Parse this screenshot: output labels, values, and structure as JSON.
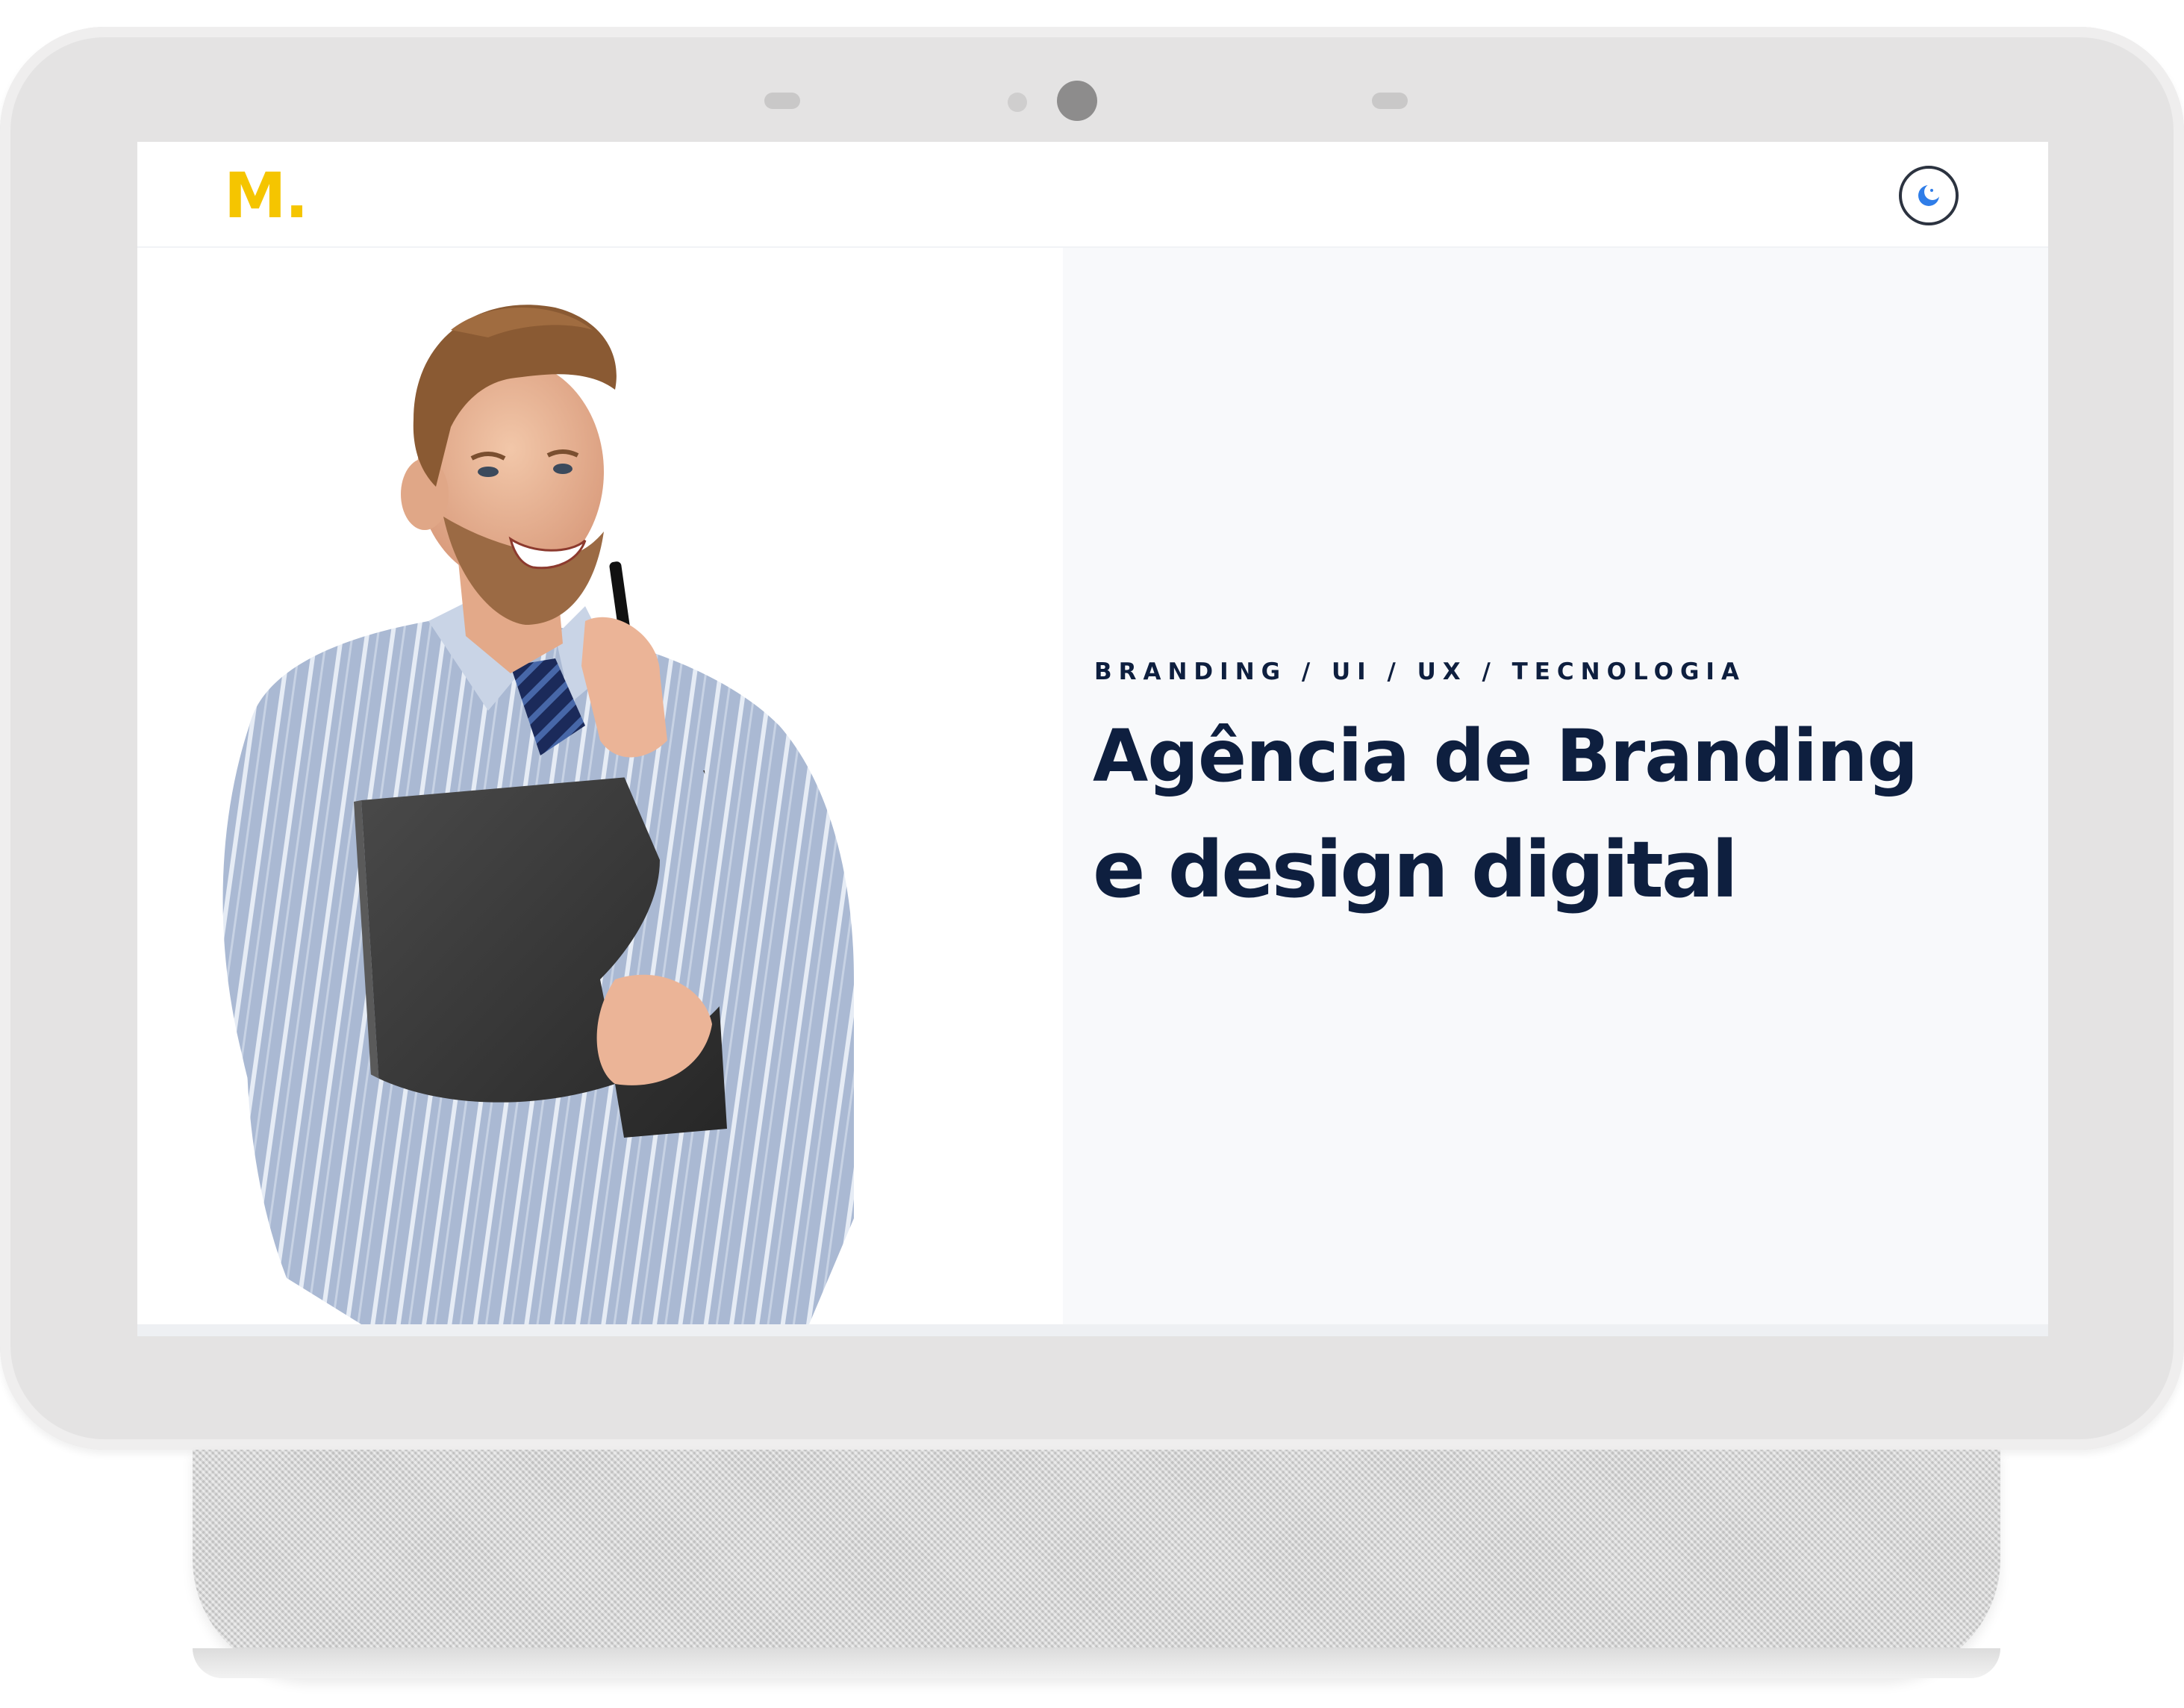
{
  "header": {
    "logo_text": "M.",
    "theme_toggle_icon": "moon-icon"
  },
  "hero": {
    "eyebrow": "BRANDING / UI / UX / TECNOLOGIA",
    "headline_line1": "Agência de Branding",
    "headline_line2": "e design digital",
    "image_icon": "businessman-photo"
  },
  "colors": {
    "brand_yellow": "#f5c500",
    "navy_text": "#0e1f3f",
    "right_panel_bg": "#f8f9fb",
    "device_frame": "#e4e3e3",
    "toggle_accent": "#2f7de8"
  }
}
